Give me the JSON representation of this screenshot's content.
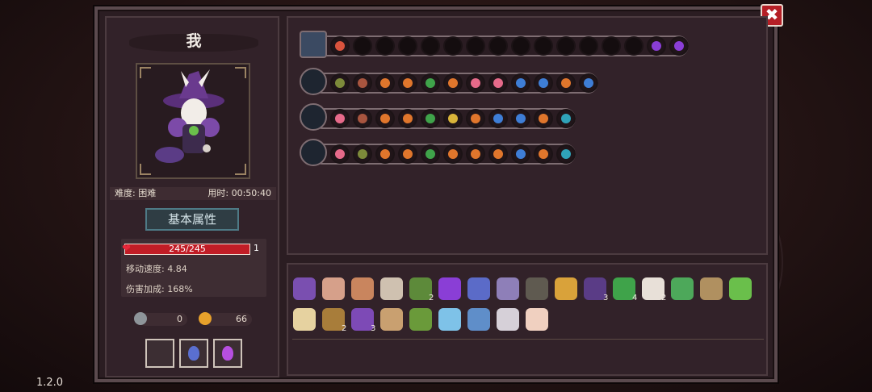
{
  "player": {
    "name": "我",
    "difficulty": "难度: 困难",
    "time": "用时: 00:50:40"
  },
  "tab_label": "基本属性",
  "hp": {
    "text": "245/245",
    "level": "1"
  },
  "stats": {
    "move_speed": "移动速度: 4.84",
    "damage_bonus": "伤害加成: 168%"
  },
  "resources": {
    "keys": "0",
    "coins": "66"
  },
  "version": "1.2.0",
  "close_label": "✖",
  "colors": {
    "frame": "#5b4a4e",
    "panel": "#322229",
    "hp": "#c11d26",
    "accent_teal": "#4e7a86",
    "close": "#b51f26"
  },
  "skill_rows": [
    {
      "icon": "chest-icon",
      "orbs": [
        "red",
        "dark",
        "dark",
        "dark",
        "dark",
        "dark",
        "dark",
        "dark",
        "dark",
        "dark",
        "dark",
        "dark",
        "dark",
        "dark",
        "purple",
        "purple"
      ]
    },
    {
      "icon": "staff-icon",
      "orbs": [
        "olive",
        "brown",
        "orange",
        "orange",
        "green",
        "orange",
        "pink",
        "pink",
        "blue",
        "blue",
        "orange",
        "blue"
      ]
    },
    {
      "icon": "wand-icon",
      "orbs": [
        "pink",
        "brown",
        "orange",
        "orange",
        "green",
        "yellow",
        "orange",
        "blue",
        "blue",
        "orange",
        "teal"
      ]
    },
    {
      "icon": "bouquet-icon",
      "orbs": [
        "pink",
        "olive",
        "orange",
        "orange",
        "green",
        "orange",
        "orange",
        "orange",
        "blue",
        "orange",
        "teal"
      ]
    }
  ],
  "items_row1": [
    {
      "name": "hair-item-icon",
      "count": ""
    },
    {
      "name": "meat-item-icon",
      "count": ""
    },
    {
      "name": "egg-item-icon",
      "count": ""
    },
    {
      "name": "horn-item-icon",
      "count": ""
    },
    {
      "name": "leaf-item-icon",
      "count": "2"
    },
    {
      "name": "shield-item-icon",
      "count": ""
    },
    {
      "name": "glove-item-icon",
      "count": ""
    },
    {
      "name": "dagger-item-icon",
      "count": ""
    },
    {
      "name": "cloak-item-icon",
      "count": ""
    },
    {
      "name": "goblet-item-icon",
      "count": ""
    },
    {
      "name": "hat-item-icon",
      "count": "3"
    },
    {
      "name": "clover-item-icon",
      "count": "4"
    },
    {
      "name": "fangs-item-icon",
      "count": "2"
    },
    {
      "name": "flower-item-icon",
      "count": ""
    },
    {
      "name": "doll-item-icon",
      "count": ""
    },
    {
      "name": "sprout-item-icon",
      "count": ""
    }
  ],
  "items_row2": [
    {
      "name": "bun-item-icon",
      "count": ""
    },
    {
      "name": "pickaxe-item-icon",
      "count": "2"
    },
    {
      "name": "wizard-hat-item-icon",
      "count": "3"
    },
    {
      "name": "hourglass-item-icon",
      "count": ""
    },
    {
      "name": "skull-item-icon",
      "count": ""
    },
    {
      "name": "crystal-item-icon",
      "count": ""
    },
    {
      "name": "magnifier-item-icon",
      "count": ""
    },
    {
      "name": "gem-item-icon",
      "count": ""
    },
    {
      "name": "feather-item-icon",
      "count": ""
    }
  ]
}
